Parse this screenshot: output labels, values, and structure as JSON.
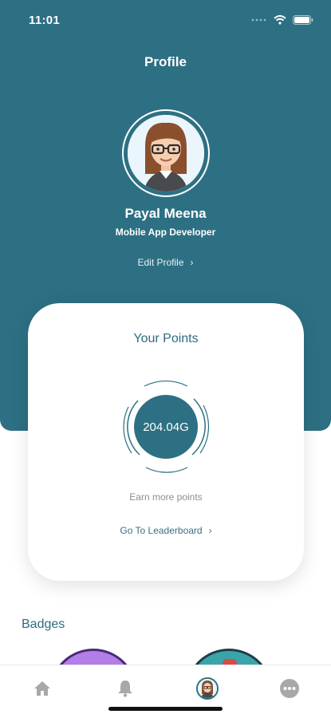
{
  "status_bar": {
    "time": "11:01"
  },
  "header": {
    "title": "Profile"
  },
  "user": {
    "name": "Payal Meena",
    "role": "Mobile App Developer",
    "edit_label": "Edit Profile",
    "edit_chevron": "›"
  },
  "points_card": {
    "title": "Your Points",
    "value": "204.04G",
    "earn_more": "Earn more points",
    "leaderboard_label": "Go To Leaderboard",
    "leaderboard_chevron": "›"
  },
  "badges": {
    "heading": "Badges"
  },
  "tab_bar": {
    "tabs": [
      "home-icon",
      "bell-icon",
      "avatar",
      "more-icon"
    ]
  },
  "colors": {
    "primary": "#2d7083",
    "card": "#ffffff",
    "muted_text": "#8a8f93",
    "accent_text": "#2d6b80"
  }
}
